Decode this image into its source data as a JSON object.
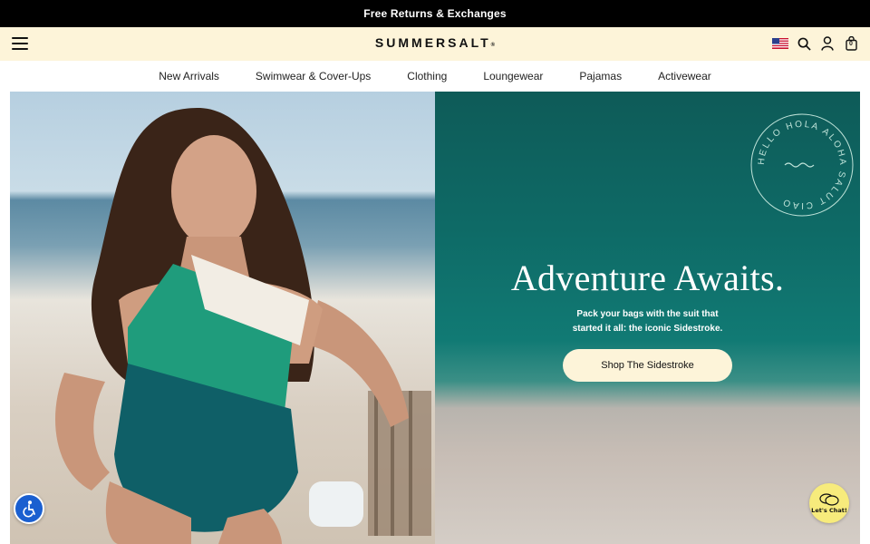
{
  "announcement": "Free Returns & Exchanges",
  "header": {
    "logo": "SUMMERSALT",
    "logo_mark": "®",
    "icons": [
      "menu-icon",
      "us-flag-icon",
      "search-icon",
      "account-icon",
      "cart-icon"
    ],
    "cart_count": "0"
  },
  "nav": {
    "items": [
      "New Arrivals",
      "Swimwear & Cover-Ups",
      "Clothing",
      "Loungewear",
      "Pajamas",
      "Activewear"
    ]
  },
  "hero": {
    "title": "Adventure Awaits.",
    "subtitle": "Pack your bags with the suit that started it all: the iconic Sidestroke.",
    "cta": "Shop The Sidestroke",
    "stamp_words": "HELLO HOLA ALOHA SALUT CIAO"
  },
  "floating": {
    "chat_label": "Let's Chat!",
    "accessibility_icon": "accessibility-icon"
  },
  "colors": {
    "announcement_bg": "#000000",
    "header_bg": "#fdf4d9",
    "cta_bg": "#fdf4d9",
    "accessibility_bg": "#1a5fd0",
    "chat_bg": "#f7eb7c"
  }
}
